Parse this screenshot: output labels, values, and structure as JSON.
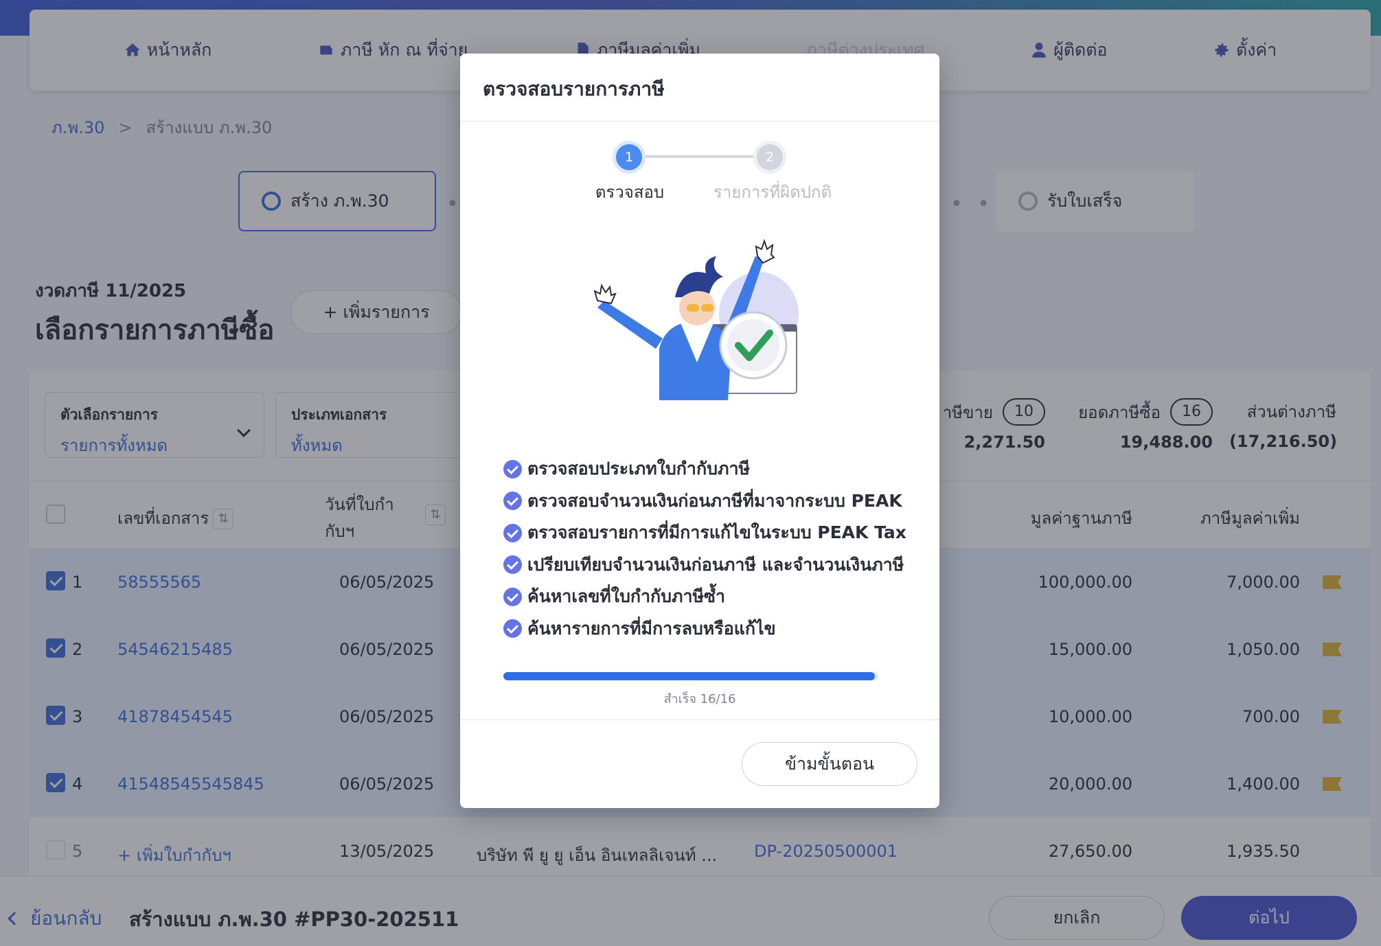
{
  "nav": {
    "items": [
      {
        "label": "หน้าหลัก",
        "icon": "home-icon"
      },
      {
        "label": "ภาษี หัก ณ ที่จ่าย",
        "icon": "wallet-icon"
      },
      {
        "label": "ภาษีมูลค่าเพิ่ม",
        "icon": "document-icon"
      },
      {
        "label": "ภาษีต่างประเทศ",
        "icon": ""
      },
      {
        "label": "ผู้ติดต่อ",
        "icon": "user-icon"
      },
      {
        "label": "ตั้งค่า",
        "icon": "gear-icon"
      }
    ]
  },
  "breadcrumb": {
    "root": "ภ.พ.30",
    "separator": ">",
    "current": "สร้างแบบ ภ.พ.30"
  },
  "workflow": {
    "step_first": "สร้าง ภ.พ.30",
    "step_last": "รับใบเสร็จ",
    "dots": "• • •"
  },
  "page": {
    "period": "งวดภาษี 11/2025",
    "title": "เลือกรายการภาษีซื้อ",
    "add_label": "+ เพิ่มรายการ"
  },
  "filters": {
    "options_label": "ตัวเลือกรายการ",
    "options_value": "รายการทั้งหมด",
    "doctype_label": "ประเภทเอกสาร",
    "doctype_value": "ทั้งหมด"
  },
  "summary": {
    "sales_label": "าษีขาย",
    "sales_count": "10",
    "sales_amount": "2,271.50",
    "purchase_label": "ยอดภาษีซื้อ",
    "purchase_count": "16",
    "purchase_amount": "19,488.00",
    "diff_label": "ส่วนต่างภาษี",
    "diff_amount": "(17,216.50)"
  },
  "table": {
    "headers": {
      "doc_no": "เลขที่เอกสาร",
      "date_line1": "วันที่ใบกำ",
      "date_line2": "กับฯ",
      "base": "มูลค่าฐานภาษี",
      "vat": "ภาษีมูลค่าเพิ่ม"
    },
    "rows": [
      {
        "no": "1",
        "doc": "58555565",
        "date": "06/05/2025",
        "base": "100,000.00",
        "vat": "7,000.00",
        "checked": true
      },
      {
        "no": "2",
        "doc": "54546215485",
        "date": "06/05/2025",
        "base": "15,000.00",
        "vat": "1,050.00",
        "checked": true
      },
      {
        "no": "3",
        "doc": "41878454545",
        "date": "06/05/2025",
        "base": "10,000.00",
        "vat": "700.00",
        "checked": true
      },
      {
        "no": "4",
        "doc": "41548545545845",
        "date": "06/05/2025",
        "base": "20,000.00",
        "vat": "1,400.00",
        "checked": true
      },
      {
        "no": "5",
        "doc": "+ เพิ่มใบกำกับฯ",
        "date": "13/05/2025",
        "company": "บริษัท พี ยู ยู เอ็น อินเทลลิเจนท์ ...",
        "ref": "DP-20250500001",
        "base": "27,650.00",
        "vat": "1,935.50",
        "checked": false
      }
    ]
  },
  "footer": {
    "back_label": "ย้อนกลับ",
    "title": "สร้างแบบ ภ.พ.30 #PP30-202511",
    "cancel_label": "ยกเลิก",
    "next_label": "ต่อไป"
  },
  "modal": {
    "title": "ตรวจสอบรายการภาษี",
    "steps": [
      {
        "number": "1",
        "label": "ตรวจสอบ",
        "active": true
      },
      {
        "number": "2",
        "label": "รายการที่ผิดปกติ",
        "active": false
      }
    ],
    "checks": [
      "ตรวจสอบประเภทใบกำกับภาษี",
      "ตรวจสอบจำนวนเงินก่อนภาษีที่มาจากระบบ PEAK",
      "ตรวจสอบรายการที่มีการแก้ไขในระบบ PEAK Tax",
      "เปรียบเทียบจำนวนเงินก่อนภาษี และจำนวนเงินภาษี",
      "ค้นหาเลขที่ใบกำกับภาษีซ้ำ",
      "ค้นหารายการที่มีการลบหรือแก้ไข"
    ],
    "progress_fraction": 0.99,
    "progress_text": "สำเร็จ 16/16",
    "skip_label": "ข้ามขั้นตอน"
  },
  "colors": {
    "accent": "#3f6ed9",
    "primary_button": "#4b56d2",
    "check": "#6573e8",
    "progress": "#2f6ee6",
    "flag": "#e0b33a"
  }
}
